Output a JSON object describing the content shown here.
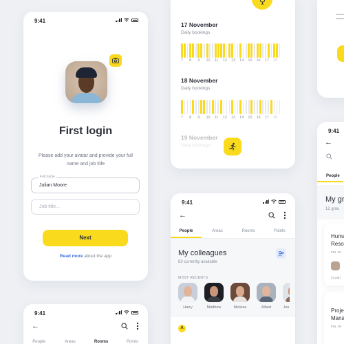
{
  "status": {
    "time": "9:41"
  },
  "login": {
    "title": "First login",
    "description": "Please add your avatar and provide your full name and job title",
    "name_field": {
      "label": "Full name",
      "value": "Julian Moore"
    },
    "job_field": {
      "placeholder": "Job title..."
    },
    "next_label": "Next",
    "read_more_link": "Read more",
    "read_more_rest": " about the app"
  },
  "bookings": {
    "days": [
      {
        "title": "17 November",
        "subtitle": "Daily bookings"
      },
      {
        "title": "18 November",
        "subtitle": "Daily bookings"
      },
      {
        "title": "19 November",
        "subtitle": "Daily bookings"
      }
    ],
    "hours": [
      "7",
      "8",
      "9",
      "10",
      "11",
      "12",
      "13",
      "14",
      "15",
      "16",
      "17",
      "18"
    ],
    "accent": "#fada1d",
    "empty": "#e6e8ec",
    "day1_busy": [
      1,
      1,
      0,
      1,
      1,
      0,
      1,
      1,
      0,
      1,
      0,
      0,
      1,
      1,
      1,
      1,
      0,
      1,
      1,
      0,
      0,
      1,
      0,
      0,
      1,
      1,
      0,
      1,
      1,
      0,
      0,
      1,
      0,
      1,
      1,
      0
    ],
    "day2_busy": [
      1,
      0,
      0,
      0,
      1,
      0,
      0,
      1,
      1,
      0,
      0,
      1,
      0,
      0,
      1,
      0,
      0,
      0,
      1,
      0,
      0,
      1,
      0,
      0,
      0,
      1,
      0,
      0,
      1,
      0,
      0,
      0,
      1,
      0,
      0,
      0
    ]
  },
  "colleagues": {
    "tabs": [
      "People",
      "Areas",
      "Rooms",
      "Points"
    ],
    "active_tab": "People",
    "title": "My colleagues",
    "subtitle": "83 currently available",
    "recents_label": "MOST RECENTS",
    "people": [
      "Harry",
      "Matthew",
      "Melissa",
      "Albert",
      "Jes"
    ],
    "letter": "A"
  },
  "bottom_card": {
    "tabs": [
      "People",
      "Areas",
      "Rooms",
      "Points"
    ]
  },
  "right_groups": {
    "tab": "People",
    "title": "My gr",
    "subtitle": "12 grou",
    "item1": "Huma",
    "item1b": "Resou",
    "item1c": "FIN, PA",
    "item1d": "32 part",
    "item2": "Proje",
    "item2b": "Mana",
    "item2c": "FIN, PA"
  }
}
